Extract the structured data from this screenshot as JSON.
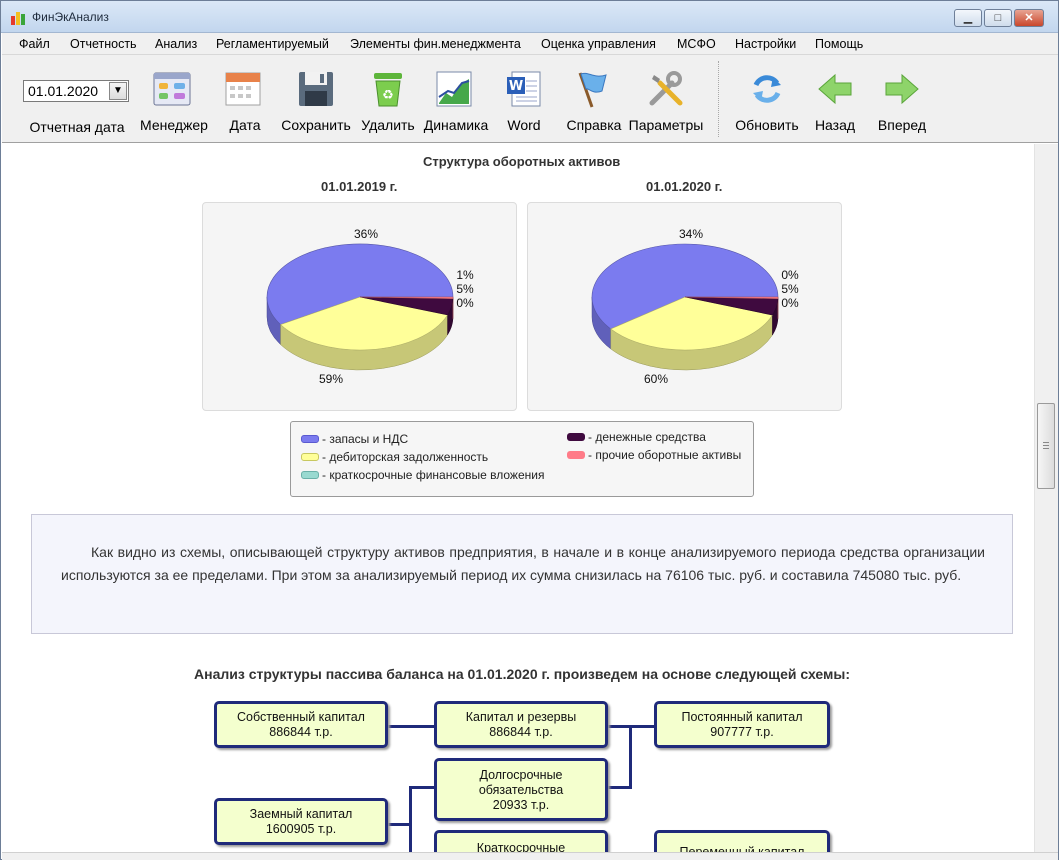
{
  "window": {
    "title": "ФинЭкАнализ",
    "minimize": "▁",
    "maximize": "□",
    "close": "✕"
  },
  "menu": [
    "Файл",
    "Отчетность",
    "Анализ",
    "Регламентируемый",
    "Элементы фин.менеджмента",
    "Оценка управления",
    "МСФО",
    "Настройки",
    "Помощь"
  ],
  "toolbar": {
    "date_value": "01.01.2020",
    "date_label": "Отчетная дата",
    "buttons": [
      {
        "label": "Менеджер",
        "icon": "manager-icon"
      },
      {
        "label": "Дата",
        "icon": "calendar-icon"
      },
      {
        "label": "Сохранить",
        "icon": "save-icon"
      },
      {
        "label": "Удалить",
        "icon": "recycle-bin-icon"
      },
      {
        "label": "Динамика",
        "icon": "dynamics-chart-icon"
      },
      {
        "label": "Word",
        "icon": "word-icon"
      },
      {
        "label": "Справка",
        "icon": "help-flag-icon"
      },
      {
        "label": "Параметры",
        "icon": "tools-icon"
      },
      {
        "label": "Обновить",
        "icon": "refresh-icon"
      },
      {
        "label": "Назад",
        "icon": "arrow-left-icon"
      },
      {
        "label": "Вперед",
        "icon": "arrow-right-icon"
      }
    ]
  },
  "assets_section": {
    "title": "Структура оборотных активов",
    "chart_data": [
      {
        "type": "pie",
        "title": "01.01.2019 г.",
        "slices": [
          {
            "name": "запасы и НДС",
            "value": 59,
            "label": "59%",
            "color": "#7b7bef"
          },
          {
            "name": "дебиторская задолженность",
            "value": 36,
            "label": "36%",
            "color": "#ffff99"
          },
          {
            "name": "краткосрочные финансовые вложения",
            "value": 0,
            "label": "",
            "color": "#99d9d0"
          },
          {
            "name": "денежные средства",
            "value": 5,
            "label": "5%",
            "color": "#3f0a3f"
          },
          {
            "name": "прочие оборотные активы",
            "value": 0.5,
            "label": "0%",
            "color": "#ff7b88"
          }
        ],
        "extra_label": "1%"
      },
      {
        "type": "pie",
        "title": "01.01.2020 г.",
        "slices": [
          {
            "name": "запасы и НДС",
            "value": 60,
            "label": "60%",
            "color": "#7b7bef"
          },
          {
            "name": "дебиторская задолженность",
            "value": 34,
            "label": "34%",
            "color": "#ffff99"
          },
          {
            "name": "краткосрочные финансовые вложения",
            "value": 0,
            "label": "",
            "color": "#99d9d0"
          },
          {
            "name": "денежные средства",
            "value": 5,
            "label": "5%",
            "color": "#3f0a3f"
          },
          {
            "name": "прочие оборотные активы",
            "value": 0.5,
            "label": "0%",
            "color": "#ff7b88"
          }
        ],
        "extra_label": "0%"
      }
    ],
    "legend": [
      {
        "label": "- запасы и НДС",
        "color": "#7b7bef"
      },
      {
        "label": "- дебиторская задолженность",
        "color": "#ffff99"
      },
      {
        "label": "- краткосрочные финансовые вложения",
        "color": "#99d9d0"
      },
      {
        "label": "- денежные средства",
        "color": "#3f0a3f"
      },
      {
        "label": "- прочие оборотные активы",
        "color": "#ff7b88"
      }
    ]
  },
  "analysis_text": "Как видно из схемы, описывающей структуру активов предприятия, в начале и в конце анализируемого периода средства организации используются за ее пределами. При этом за анализируемый период их сумма снизилась на 76106 тыс. руб. и составила 745080 тыс. руб.",
  "scheme": {
    "title": "Анализ структуры пассива баланса на 01.01.2020 г. произведем на основе следующей схемы:",
    "nodes": {
      "equity": "Собственный капитал\n886844 т.р.",
      "capital_reserves": "Капитал и резервы\n886844 т.р.",
      "permanent_capital": "Постоянный капитал\n907777 т.р.",
      "long_term": "Долгосрочные\nобязательства\n20933 т.р.",
      "borrowed": "Заемный капитал\n1600905 т.р.",
      "short_term": "Краткосрочные",
      "variable_capital": "Переменный капитал"
    }
  }
}
